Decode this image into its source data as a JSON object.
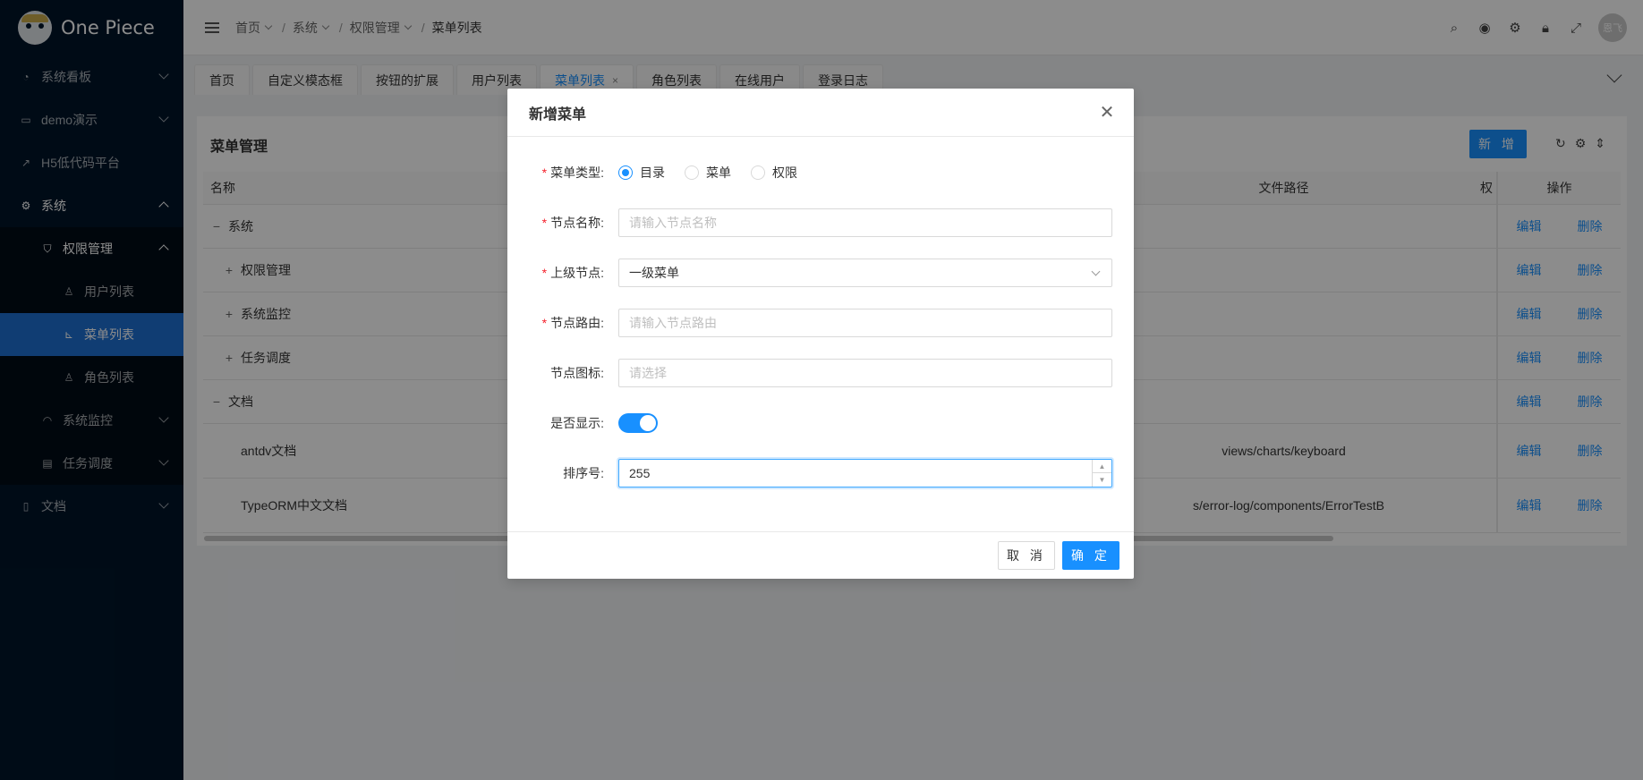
{
  "app": {
    "title": "One Piece"
  },
  "sidebar": {
    "items": [
      {
        "label": "系统看板",
        "icon": "dashboard-icon"
      },
      {
        "label": "demo演示",
        "icon": "desktop-icon"
      },
      {
        "label": "H5低代码平台",
        "icon": "external-link-icon"
      },
      {
        "label": "系统",
        "icon": "setting-icon"
      },
      {
        "label": "权限管理",
        "icon": "safety-icon"
      },
      {
        "label": "用户列表",
        "icon": "user-icon"
      },
      {
        "label": "菜单列表",
        "icon": "bar-chart-icon"
      },
      {
        "label": "角色列表",
        "icon": "user-switch-icon"
      },
      {
        "label": "系统监控",
        "icon": "monitor-icon"
      },
      {
        "label": "任务调度",
        "icon": "schedule-icon"
      },
      {
        "label": "文档",
        "icon": "book-icon"
      }
    ]
  },
  "header": {
    "breadcrumb": [
      "首页",
      "系统",
      "权限管理",
      "菜单列表"
    ],
    "avatar_text": "恩飞"
  },
  "tabs": [
    {
      "label": "首页"
    },
    {
      "label": "自定义模态框"
    },
    {
      "label": "按钮的扩展"
    },
    {
      "label": "用户列表"
    },
    {
      "label": "菜单列表",
      "close": "×"
    },
    {
      "label": "角色列表"
    },
    {
      "label": "在线用户"
    },
    {
      "label": "登录日志"
    }
  ],
  "card": {
    "title": "菜单管理",
    "add_label": "新 增",
    "columns": {
      "name": "名称",
      "path": "文件路径",
      "perm": "权",
      "ops": "操作"
    },
    "rows": [
      {
        "expander": "−",
        "name": "系统",
        "path": ""
      },
      {
        "expander": "+",
        "name": "权限管理",
        "path": ""
      },
      {
        "expander": "+",
        "name": "系统监控",
        "path": ""
      },
      {
        "expander": "+",
        "name": "任务调度",
        "path": ""
      },
      {
        "expander": "−",
        "name": "文档",
        "path": ""
      },
      {
        "expander": "",
        "name": "antdv文档",
        "path": "views/charts/keyboard"
      },
      {
        "expander": "",
        "name": "TypeORM中文文档",
        "path": "s/error-log/components/ErrorTestB"
      }
    ],
    "edit_label": "编辑",
    "delete_label": "删除"
  },
  "modal": {
    "title": "新增菜单",
    "menu_type": {
      "label": "菜单类型",
      "options": [
        "目录",
        "菜单",
        "权限"
      ],
      "selected": "目录"
    },
    "node_name": {
      "label": "节点名称",
      "placeholder": "请输入节点名称"
    },
    "parent_node": {
      "label": "上级节点",
      "value": "一级菜单"
    },
    "node_route": {
      "label": "节点路由",
      "placeholder": "请输入节点路由"
    },
    "node_icon": {
      "label": "节点图标",
      "placeholder": "请选择"
    },
    "show": {
      "label": "是否显示",
      "value": true
    },
    "sort": {
      "label": "排序号",
      "value": "255"
    },
    "cancel_label": "取 消",
    "ok_label": "确 定"
  },
  "colors": {
    "primary": "#1890ff",
    "sidebar_bg": "#001529",
    "required": "#f5222d"
  }
}
